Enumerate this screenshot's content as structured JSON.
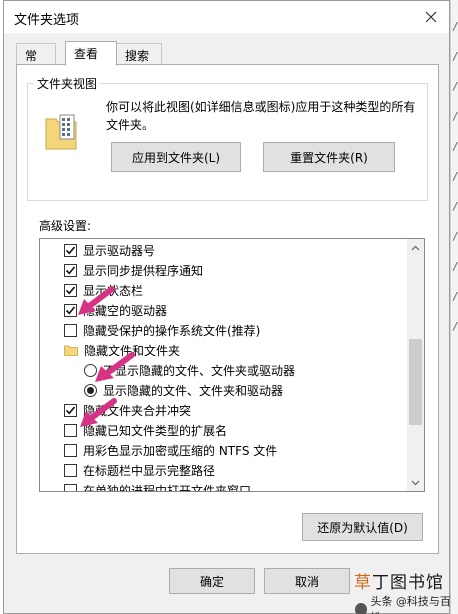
{
  "dialog": {
    "title": "文件夹选项",
    "tabs": [
      {
        "label": "常规"
      },
      {
        "label": "查看"
      },
      {
        "label": "搜索"
      }
    ],
    "folder_views": {
      "legend": "文件夹视图",
      "description": "你可以将此视图(如详细信息或图标)应用于这种类型的所有文件夹。",
      "apply_button": "应用到文件夹(L)",
      "reset_button": "重置文件夹(R)"
    },
    "advanced": {
      "label": "高级设置:",
      "items": [
        {
          "type": "checkbox",
          "checked": true,
          "label": "显示驱动器号"
        },
        {
          "type": "checkbox",
          "checked": true,
          "label": "显示同步提供程序通知"
        },
        {
          "type": "checkbox",
          "checked": true,
          "label": "显示状态栏"
        },
        {
          "type": "checkbox",
          "checked": true,
          "label": "隐藏空的驱动器"
        },
        {
          "type": "checkbox",
          "checked": false,
          "label": "隐藏受保护的操作系统文件(推荐)"
        },
        {
          "type": "folder",
          "label": "隐藏文件和文件夹"
        },
        {
          "type": "radio",
          "checked": false,
          "label": "不显示隐藏的文件、文件夹或驱动器"
        },
        {
          "type": "radio",
          "checked": true,
          "label": "显示隐藏的文件、文件夹和驱动器"
        },
        {
          "type": "checkbox",
          "checked": true,
          "label": "隐藏文件夹合并冲突"
        },
        {
          "type": "checkbox",
          "checked": false,
          "label": "隐藏已知文件类型的扩展名"
        },
        {
          "type": "checkbox",
          "checked": false,
          "label": "用彩色显示加密或压缩的 NTFS 文件"
        },
        {
          "type": "checkbox",
          "checked": false,
          "label": "在标题栏中显示完整路径"
        },
        {
          "type": "checkbox",
          "checked": false,
          "label": "在单独的进程中打开文件夹窗口"
        }
      ],
      "restore_button": "还原为默认值(D)"
    },
    "ok_button": "确定",
    "cancel_button": "取消"
  },
  "watermark": {
    "logo_prefix": "草",
    "logo_rest": "丁图书馆",
    "caption": "头条 @科技与百姓"
  },
  "colors": {
    "arrow": "#d63384",
    "accent_logo": "#d2691e"
  }
}
